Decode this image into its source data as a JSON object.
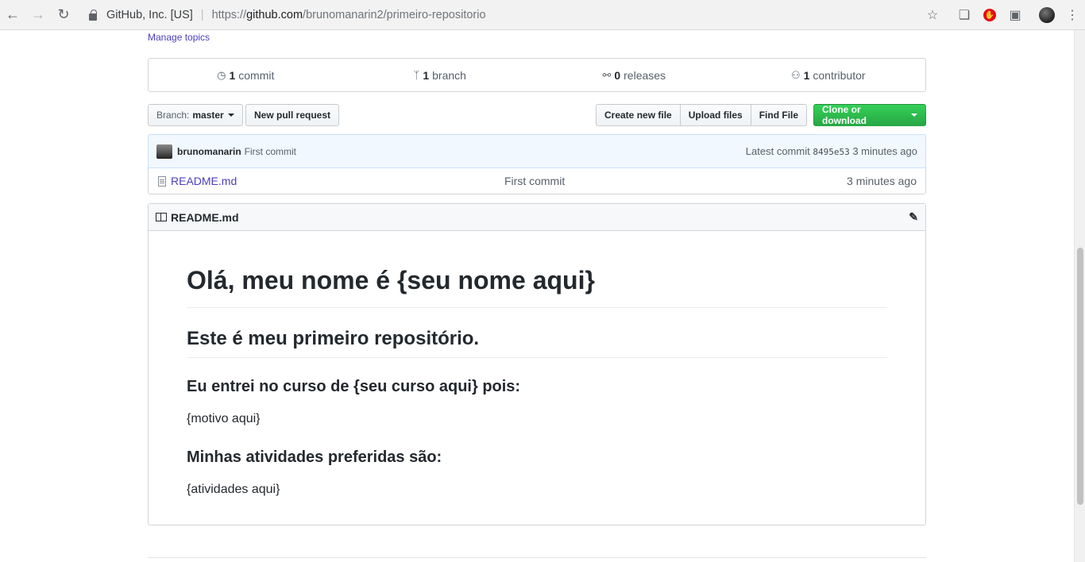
{
  "browser": {
    "site_identity": "GitHub, Inc. [US]",
    "url_scheme": "https://",
    "url_host": "github.com",
    "url_path": "/brunomanarin2/primeiro-repositorio"
  },
  "repo": {
    "manage_topics": "Manage topics",
    "summary": [
      {
        "icon": "history-icon",
        "count": "1",
        "label": "commit"
      },
      {
        "icon": "branch-icon",
        "count": "1",
        "label": "branch"
      },
      {
        "icon": "tag-icon",
        "count": "0",
        "label": "releases"
      },
      {
        "icon": "people-icon",
        "count": "1",
        "label": "contributor"
      }
    ],
    "branch_prefix": "Branch:",
    "branch_name": "master",
    "new_pull_request": "New pull request",
    "create_new_file": "Create new file",
    "upload_files": "Upload files",
    "find_file": "Find File",
    "clone_or_download": "Clone or download",
    "latest_commit": {
      "author": "brunomanarin",
      "message": "First commit",
      "label": "Latest commit",
      "sha": "8495e53",
      "age": "3 minutes ago"
    },
    "files": [
      {
        "name": "README.md",
        "message": "First commit",
        "age": "3 minutes ago"
      }
    ]
  },
  "readme": {
    "title": "README.md",
    "h1": "Olá, meu nome é {seu nome aqui}",
    "h2": "Este é meu primeiro repositório.",
    "h3a": "Eu entrei no curso de {seu curso aqui} pois:",
    "p1": "{motivo aqui}",
    "h3b": "Minhas atividades preferidas são:",
    "p2": "{atividades aqui}"
  },
  "colors": {
    "link": "#4a3fbd",
    "primary_button": "#28a745",
    "commit_tease_bg": "#f1f8ff"
  }
}
